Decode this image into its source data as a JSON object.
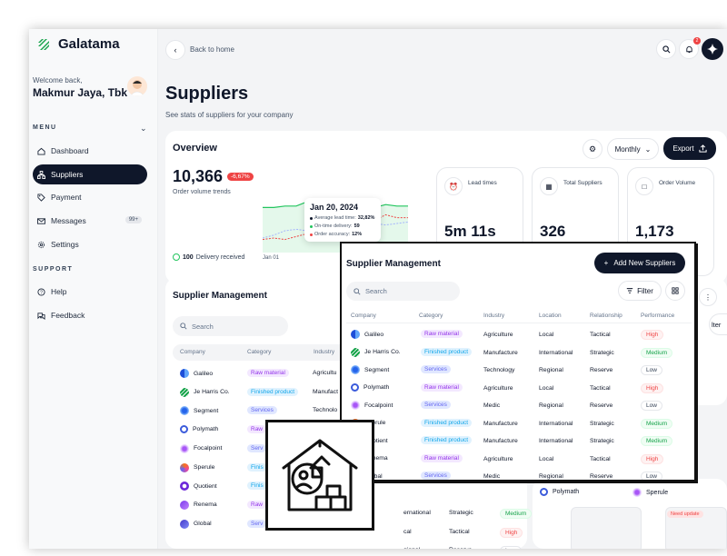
{
  "app": {
    "name": "Galatama"
  },
  "user": {
    "welcome": "Welcome back,",
    "name": "Makmur Jaya, Tbk"
  },
  "sidebar": {
    "menu_label": "MENU",
    "support_label": "SUPPORT",
    "items": [
      {
        "label": "Dashboard",
        "icon": "home-icon"
      },
      {
        "label": "Suppliers",
        "icon": "hierarchy-icon",
        "active": true
      },
      {
        "label": "Payment",
        "icon": "tag-icon"
      },
      {
        "label": "Messages",
        "icon": "mail-icon",
        "badge": "99+"
      },
      {
        "label": "Settings",
        "icon": "gear-icon"
      }
    ],
    "support_items": [
      {
        "label": "Help",
        "icon": "help-icon"
      },
      {
        "label": "Feedback",
        "icon": "feedback-icon"
      }
    ]
  },
  "header": {
    "back_label": "Back to home",
    "notification_count": "2"
  },
  "page": {
    "title": "Suppliers",
    "subtitle": "See stats of suppliers for your company"
  },
  "overview": {
    "title": "Overview",
    "period": "Monthly",
    "export_label": "Export",
    "order_volume": "10,366",
    "order_change": "-6,67%",
    "order_label": "Order volume trends",
    "delivery_count": "100",
    "delivery_label": "Delivery received",
    "x_start_label": "Jan 01",
    "tooltip": {
      "date": "Jan 20, 2024",
      "rows": [
        {
          "label": "Average lead time:",
          "value": "32,82%",
          "color": "#0f172a"
        },
        {
          "label": "On-time delivery:",
          "value": "59",
          "color": "#22c55e"
        },
        {
          "label": "Order accuracy:",
          "value": "12%",
          "color": "#ef4444"
        }
      ]
    },
    "stats": [
      {
        "label": "Lead times",
        "value": "5m 11s",
        "icon": "alarm-icon"
      },
      {
        "label": "Total Suppliers",
        "value": "326",
        "icon": "building-icon"
      },
      {
        "label": "Order Volume",
        "value": "1,173",
        "icon": "box-icon"
      }
    ]
  },
  "chart_data": {
    "type": "line",
    "series": [
      {
        "values": [
          62,
          62,
          64,
          64,
          70,
          70,
          72,
          72,
          64,
          60,
          62,
          66,
          64,
          64
        ],
        "color": "#22c55e"
      },
      {
        "values": [
          18,
          20,
          18,
          22,
          26,
          30,
          34,
          34,
          40,
          46,
          44,
          52,
          48,
          48
        ],
        "color": "#ef4444"
      },
      {
        "values": [
          20,
          24,
          30,
          32,
          30,
          34,
          38,
          40,
          42,
          44,
          40,
          38,
          40,
          42
        ],
        "color": "#a5b4fc"
      }
    ],
    "ylim": [
      0,
      100
    ]
  },
  "supplier_table": {
    "title": "Supplier Management",
    "add_label": "Add New Suppliers",
    "search_placeholder": "Search",
    "filter_label": "Filter",
    "columns": [
      "Company",
      "Category",
      "Industry",
      "Location",
      "Relationship",
      "Performance"
    ],
    "rows": [
      {
        "company": "Galileo",
        "category": "Raw material",
        "industry": "Agriculture",
        "location": "Local",
        "relationship": "Tactical",
        "performance": "High"
      },
      {
        "company": "Je Harris Co.",
        "category": "Finished product",
        "industry": "Manufacture",
        "location": "International",
        "relationship": "Strategic",
        "performance": "Medium"
      },
      {
        "company": "Segment",
        "category": "Services",
        "industry": "Technology",
        "location": "Regional",
        "relationship": "Reserve",
        "performance": "Low"
      },
      {
        "company": "Polymath",
        "category": "Raw material",
        "industry": "Agriculture",
        "location": "Local",
        "relationship": "Tactical",
        "performance": "High"
      },
      {
        "company": "Focalpoint",
        "category": "Services",
        "industry": "Medic",
        "location": "Regional",
        "relationship": "Reserve",
        "performance": "Low"
      },
      {
        "company": "Sperule",
        "category": "Finished product",
        "industry": "Manufacture",
        "location": "International",
        "relationship": "Strategic",
        "performance": "Medium"
      },
      {
        "company": "Quotient",
        "category": "Finished product",
        "industry": "Manufacture",
        "location": "International",
        "relationship": "Strategic",
        "performance": "Medium"
      },
      {
        "company": "Renema",
        "category": "Raw material",
        "industry": "Agriculture",
        "location": "Local",
        "relationship": "Tactical",
        "performance": "High"
      },
      {
        "company": "Global",
        "category": "Services",
        "industry": "Medic",
        "location": "Regional",
        "relationship": "Reserve",
        "performance": "Low"
      }
    ]
  },
  "background_table": {
    "title": "Supplier Management",
    "search_placeholder": "Search",
    "columns": [
      "Company",
      "Category",
      "Industry"
    ],
    "rows": [
      {
        "company": "Galileo",
        "category": "Raw material",
        "industry": "Agricultu"
      },
      {
        "company": "Je Harris Co.",
        "category": "Finished product",
        "industry": "Manufact"
      },
      {
        "company": "Segment",
        "category": "Services",
        "industry": "Technolo"
      },
      {
        "company": "Polymath",
        "category": "Raw",
        "industry": ""
      },
      {
        "company": "Focalpoint",
        "category": "Serv",
        "industry": ""
      },
      {
        "company": "Sperule",
        "category": "Finis",
        "industry": ""
      },
      {
        "company": "Quotient",
        "category": "Finis",
        "industry": ""
      },
      {
        "company": "Renema",
        "category": "Raw",
        "industry": ""
      },
      {
        "company": "Global",
        "category": "Serv",
        "industry": ""
      }
    ],
    "peek_rows": [
      {
        "location": "ernational",
        "relationship": "Strategic",
        "performance": "Medium"
      },
      {
        "location": "cal",
        "relationship": "Tactical",
        "performance": "High"
      },
      {
        "location": "gional",
        "relationship": "Reserve",
        "performance": "Low"
      }
    ],
    "filter_peek": "lter"
  },
  "side_panel": {
    "companies": [
      "Polymath",
      "Sperule"
    ],
    "need_update": "Need update"
  }
}
